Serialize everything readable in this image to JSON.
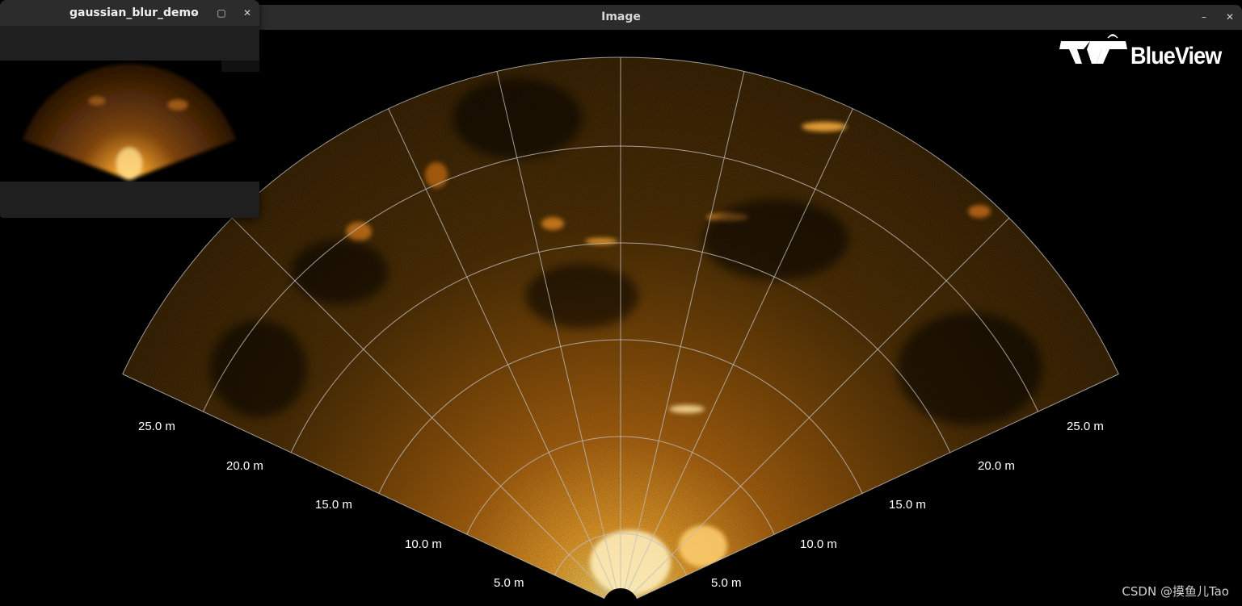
{
  "main_window": {
    "title": "Image",
    "minimize_glyph": "–",
    "close_glyph": "✕"
  },
  "demo_window": {
    "title": "gaussian_blur_demo",
    "minimize_glyph": "–",
    "maximize_glyph": "▢",
    "close_glyph": "✕"
  },
  "logo": {
    "text": "BlueView",
    "icon": "teledyne-logo-icon"
  },
  "sonar": {
    "range_rings_m": [
      5.0,
      10.0,
      15.0,
      20.0,
      25.0
    ],
    "range_labels_left": [
      "25.0 m",
      "20.0 m",
      "15.0 m",
      "10.0 m",
      "5.0 m"
    ],
    "range_labels_right": [
      "25.0 m",
      "20.0 m",
      "15.0 m",
      "10.0 m",
      "5.0 m"
    ],
    "colors": {
      "grid": "#bfbfbf",
      "echo": "#e08a20",
      "background": "#000000"
    }
  },
  "watermark": "CSDN @摸鱼儿Tao"
}
